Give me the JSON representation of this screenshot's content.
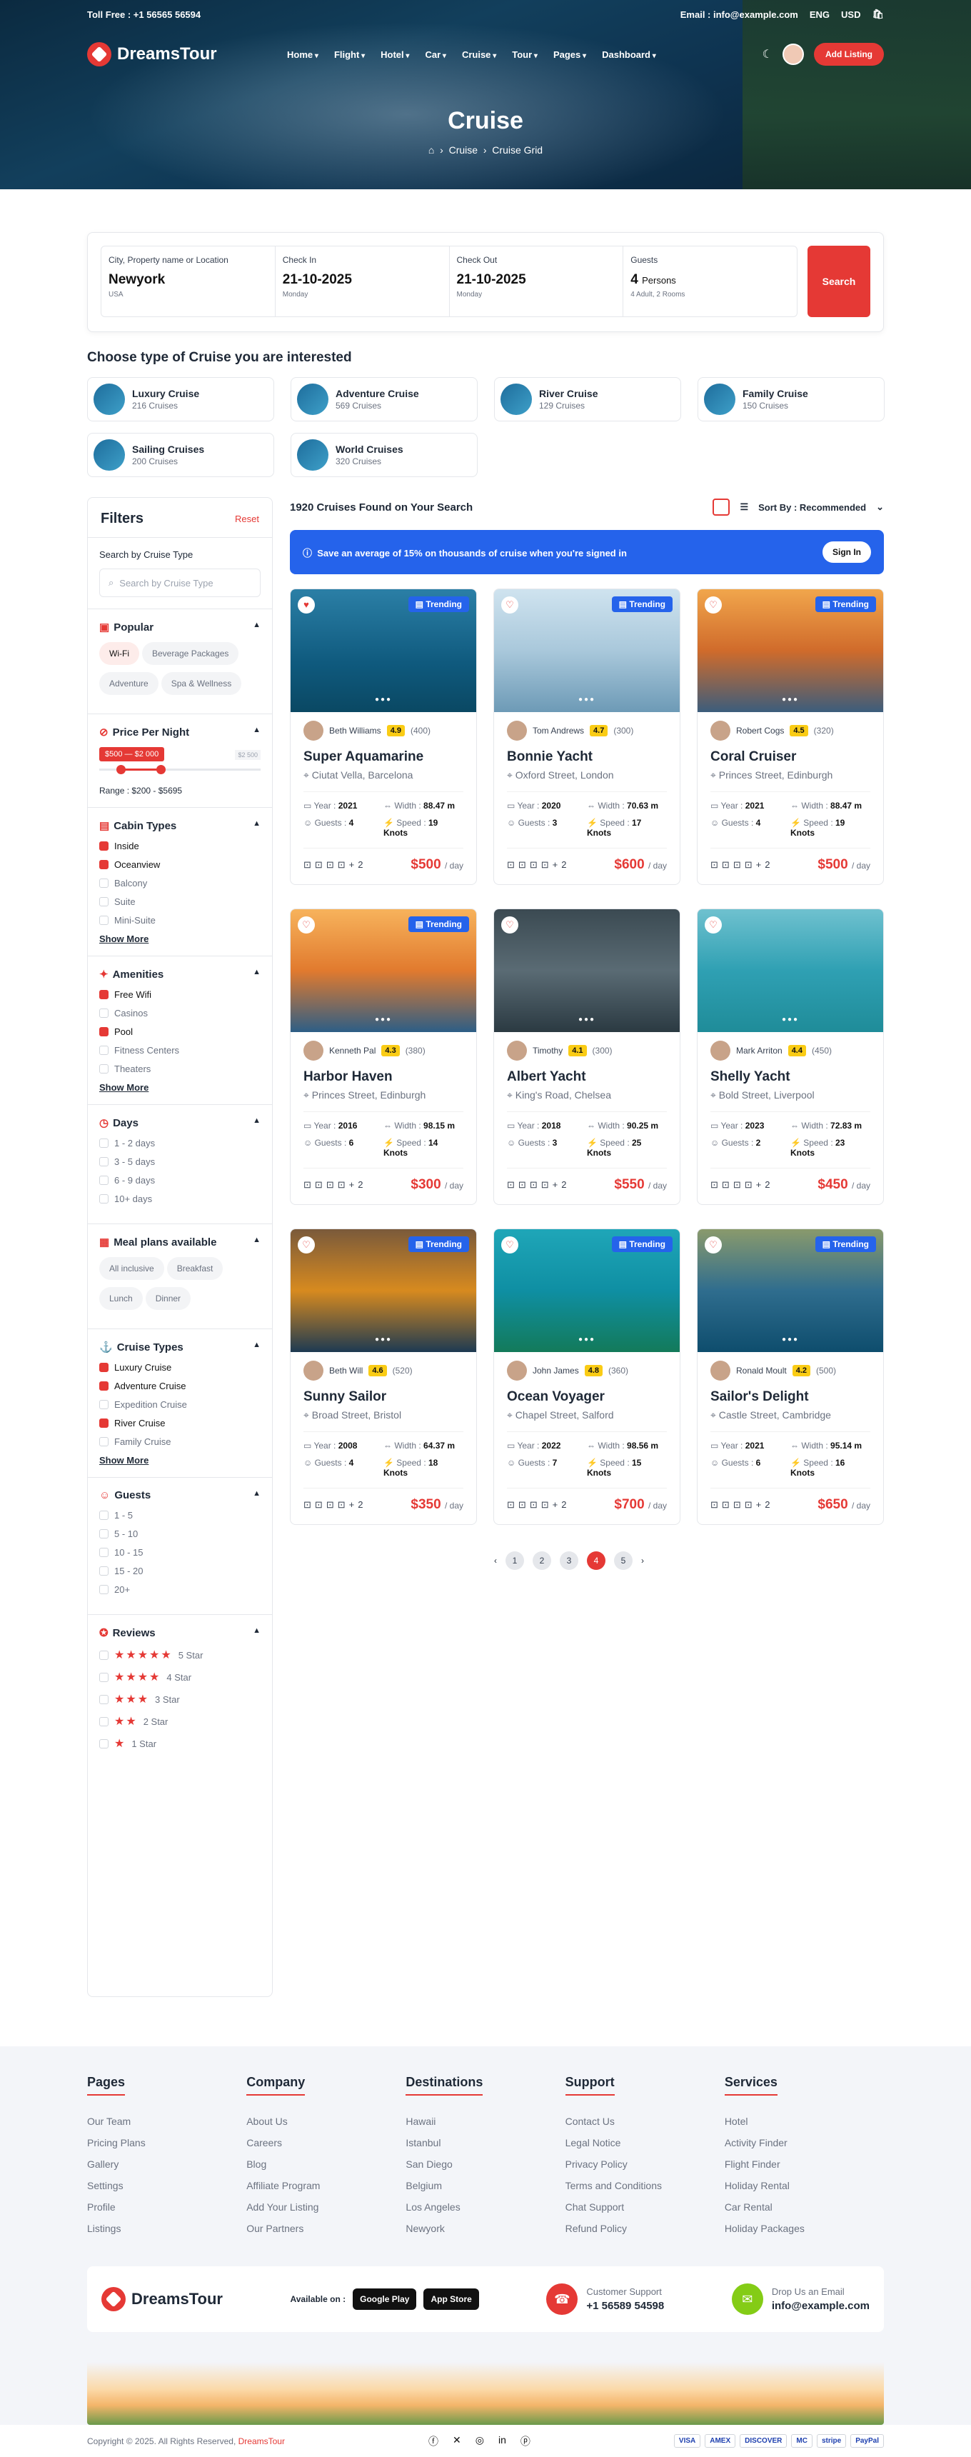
{
  "topbar": {
    "phone": "Toll Free : +1 56565 56594",
    "email": "Email : info@example.com",
    "lang": "ENG",
    "currency": "USD"
  },
  "nav": {
    "brand": "DreamsTour",
    "items": [
      "Home",
      "Flight",
      "Hotel",
      "Car",
      "Cruise",
      "Tour",
      "Pages",
      "Dashboard"
    ],
    "add_listing": "Add Listing"
  },
  "hero": {
    "title": "Cruise",
    "crumb_1": "Cruise",
    "crumb_2": "Cruise Grid"
  },
  "search": {
    "loc_label": "City, Property name or Location",
    "loc_value": "Newyork",
    "loc_sub": "USA",
    "in_label": "Check In",
    "in_value": "21-10-2025",
    "in_sub": "Monday",
    "out_label": "Check Out",
    "out_value": "21-10-2025",
    "out_sub": "Monday",
    "guests_label": "Guests",
    "guests_value": "4",
    "guests_unit": "Persons",
    "guests_sub": "4 Adult, 2 Rooms",
    "button": "Search"
  },
  "types": {
    "heading": "Choose type of Cruise you are interested",
    "items": [
      {
        "name": "Luxury Cruise",
        "count": "216 Cruises"
      },
      {
        "name": "Adventure Cruise",
        "count": "569 Cruises"
      },
      {
        "name": "River Cruise",
        "count": "129 Cruises"
      },
      {
        "name": "Family Cruise",
        "count": "150 Cruises"
      },
      {
        "name": "Sailing Cruises",
        "count": "200 Cruises"
      },
      {
        "name": "World Cruises",
        "count": "320 Cruises"
      }
    ]
  },
  "filters": {
    "title": "Filters",
    "reset": "Reset",
    "search_label": "Search by Cruise Type",
    "search_placeholder": "Search by Cruise Type",
    "popular_title": "Popular",
    "popular": [
      "Wi-Fi",
      "Beverage Packages",
      "Adventure",
      "Spa & Wellness"
    ],
    "price_title": "Price Per Night",
    "price_tag": "$500 — $2 000",
    "range": "Range : $200 - $5695",
    "price_side": "$2 500",
    "cabin_title": "Cabin Types",
    "cabin": [
      "Inside",
      "Oceanview",
      "Balcony",
      "Suite",
      "Mini-Suite"
    ],
    "amen_title": "Amenities",
    "amen": [
      "Free Wifi",
      "Casinos",
      "Pool",
      "Fitness Centers",
      "Theaters"
    ],
    "show_more": "Show More",
    "days_title": "Days",
    "days": [
      "1 - 2 days",
      "3 - 5 days",
      "6 - 9 days",
      "10+ days"
    ],
    "meal_title": "Meal plans available",
    "meals": [
      "All inclusive",
      "Breakfast",
      "Lunch",
      "Dinner"
    ],
    "ctype_title": "Cruise Types",
    "ctype": [
      "Luxury Cruise",
      "Adventure Cruise",
      "Expedition Cruise",
      "River Cruise",
      "Family Cruise"
    ],
    "guests_title": "Guests",
    "guests": [
      "1 - 5",
      "5 - 10",
      "10 - 15",
      "15 - 20",
      "20+"
    ],
    "reviews_title": "Reviews",
    "reviews": [
      "5 Star",
      "4 Star",
      "3 Star",
      "2 Star",
      "1 Star"
    ]
  },
  "results": {
    "count": "1920 Cruises Found on Your Search",
    "sort": "Sort By : Recommended",
    "banner": "Save an average of 15% on thousands of cruise when you're signed in",
    "sign_in": "Sign In",
    "trending": "Trending",
    "per_day": "/ day",
    "extra": "+2",
    "cards": [
      {
        "host": "Beth Williams",
        "rating": "4.9",
        "reviews": "(400)",
        "name": "Super Aquamarine",
        "loc": "Ciutat Vella, Barcelona",
        "year": "2021",
        "width": "88.47 m",
        "guests": "4",
        "speed": "19 Knots",
        "price": "$500",
        "trending": true
      },
      {
        "host": "Tom Andrews",
        "rating": "4.7",
        "reviews": "(300)",
        "name": "Bonnie Yacht",
        "loc": "Oxford Street, London",
        "year": "2020",
        "width": "70.63 m",
        "guests": "3",
        "speed": "17 Knots",
        "price": "$600",
        "trending": true
      },
      {
        "host": "Robert Cogs",
        "rating": "4.5",
        "reviews": "(320)",
        "name": "Coral Cruiser",
        "loc": "Princes Street, Edinburgh",
        "year": "2021",
        "width": "88.47 m",
        "guests": "4",
        "speed": "19 Knots",
        "price": "$500",
        "trending": true
      },
      {
        "host": "Kenneth Pal",
        "rating": "4.3",
        "reviews": "(380)",
        "name": "Harbor Haven",
        "loc": "Princes Street, Edinburgh",
        "year": "2016",
        "width": "98.15 m",
        "guests": "6",
        "speed": "14 Knots",
        "price": "$300",
        "trending": true
      },
      {
        "host": "Timothy",
        "rating": "4.1",
        "reviews": "(300)",
        "name": "Albert Yacht",
        "loc": "King's Road, Chelsea",
        "year": "2018",
        "width": "90.25 m",
        "guests": "3",
        "speed": "25 Knots",
        "price": "$550",
        "trending": false
      },
      {
        "host": "Mark Arriton",
        "rating": "4.4",
        "reviews": "(450)",
        "name": "Shelly Yacht",
        "loc": "Bold Street, Liverpool",
        "year": "2023",
        "width": "72.83 m",
        "guests": "2",
        "speed": "23 Knots",
        "price": "$450",
        "trending": false
      },
      {
        "host": "Beth Will",
        "rating": "4.6",
        "reviews": "(520)",
        "name": "Sunny Sailor",
        "loc": "Broad Street, Bristol",
        "year": "2008",
        "width": "64.37 m",
        "guests": "4",
        "speed": "18 Knots",
        "price": "$350",
        "trending": true
      },
      {
        "host": "John James",
        "rating": "4.8",
        "reviews": "(360)",
        "name": "Ocean Voyager",
        "loc": "Chapel Street, Salford",
        "year": "2022",
        "width": "98.56 m",
        "guests": "7",
        "speed": "15 Knots",
        "price": "$700",
        "trending": true
      },
      {
        "host": "Ronald Moult",
        "rating": "4.2",
        "reviews": "(500)",
        "name": "Sailor's Delight",
        "loc": "Castle Street, Cambridge",
        "year": "2021",
        "width": "95.14 m",
        "guests": "6",
        "speed": "16 Knots",
        "price": "$650",
        "trending": true
      }
    ],
    "labels": {
      "year": "Year :",
      "width": "Width :",
      "guests": "Guests :",
      "speed": "Speed :"
    },
    "pages": [
      "1",
      "2",
      "3",
      "4",
      "5"
    ]
  },
  "footer": {
    "cols": [
      {
        "title": "Pages",
        "links": [
          "Our Team",
          "Pricing Plans",
          "Gallery",
          "Settings",
          "Profile",
          "Listings"
        ]
      },
      {
        "title": "Company",
        "links": [
          "About Us",
          "Careers",
          "Blog",
          "Affiliate Program",
          "Add Your Listing",
          "Our Partners"
        ]
      },
      {
        "title": "Destinations",
        "links": [
          "Hawaii",
          "Istanbul",
          "San Diego",
          "Belgium",
          "Los Angeles",
          "Newyork"
        ]
      },
      {
        "title": "Support",
        "links": [
          "Contact Us",
          "Legal Notice",
          "Privacy Policy",
          "Terms and Conditions",
          "Chat Support",
          "Refund Policy"
        ]
      },
      {
        "title": "Services",
        "links": [
          "Hotel",
          "Activity Finder",
          "Flight Finder",
          "Holiday Rental",
          "Car Rental",
          "Holiday Packages"
        ]
      }
    ],
    "available": "Available on :",
    "google": "Google Play",
    "apple": "App Store",
    "support_label": "Customer Support",
    "support_value": "+1 56589 54598",
    "email_label": "Drop Us an Email",
    "email_value": "info@example.com",
    "copyright": "Copyright © 2025. All Rights Reserved,",
    "copyright_brand": "DreamsTour",
    "payments": [
      "VISA",
      "AMEX",
      "DISCOVER",
      "MC",
      "stripe",
      "PayPal"
    ]
  }
}
